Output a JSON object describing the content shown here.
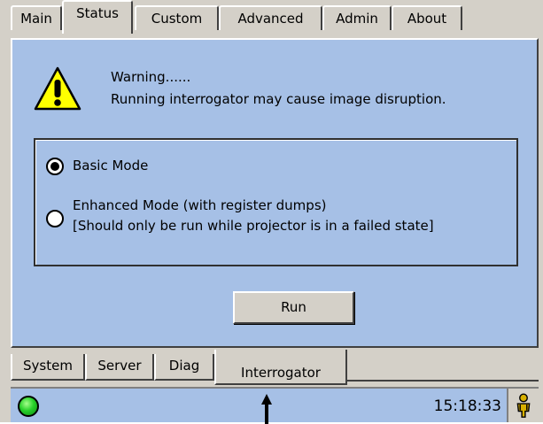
{
  "top_tabs": {
    "items": [
      {
        "label": "Main"
      },
      {
        "label": "Status"
      },
      {
        "label": "Custom"
      },
      {
        "label": "Advanced"
      },
      {
        "label": "Admin"
      },
      {
        "label": "About"
      }
    ],
    "active": "Status"
  },
  "warning": {
    "icon": "warning-triangle-icon",
    "title": "Warning......",
    "message": "Running interrogator may cause image disruption."
  },
  "mode": {
    "options": [
      {
        "line1": "Basic Mode",
        "line2": "",
        "checked": true
      },
      {
        "line1": "Enhanced Mode (with register dumps)",
        "line2": "[Should only be run while projector is in a failed state]",
        "checked": false
      }
    ]
  },
  "run_button": {
    "label": "Run"
  },
  "bottom_tabs": {
    "items": [
      {
        "label": "System"
      },
      {
        "label": "Server"
      },
      {
        "label": "Diag"
      },
      {
        "label": "Interrogator"
      }
    ],
    "active": "Interrogator"
  },
  "status_bar": {
    "indicator_color": "#28d12a",
    "time": "15:18:33",
    "user_icon": "user-icon"
  },
  "colors": {
    "panel_bg": "#a6c0e6",
    "chrome_bg": "#d4d0c8",
    "warning_yellow": "#ffff00"
  }
}
